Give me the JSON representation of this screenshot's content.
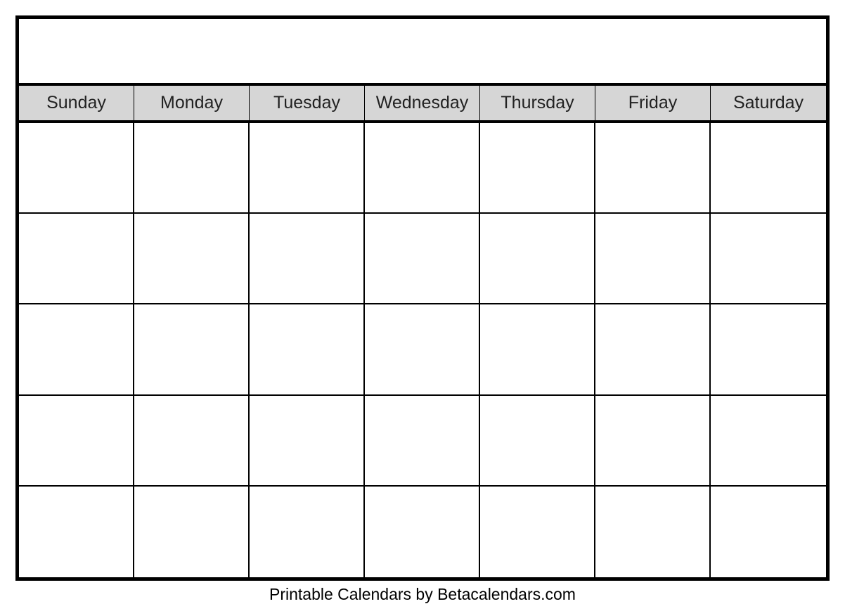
{
  "calendar": {
    "title": "",
    "days_of_week": [
      "Sunday",
      "Monday",
      "Tuesday",
      "Wednesday",
      "Thursday",
      "Friday",
      "Saturday"
    ],
    "rows": 5,
    "cols": 7
  },
  "footer": {
    "credit": "Printable Calendars by Betacalendars.com"
  }
}
